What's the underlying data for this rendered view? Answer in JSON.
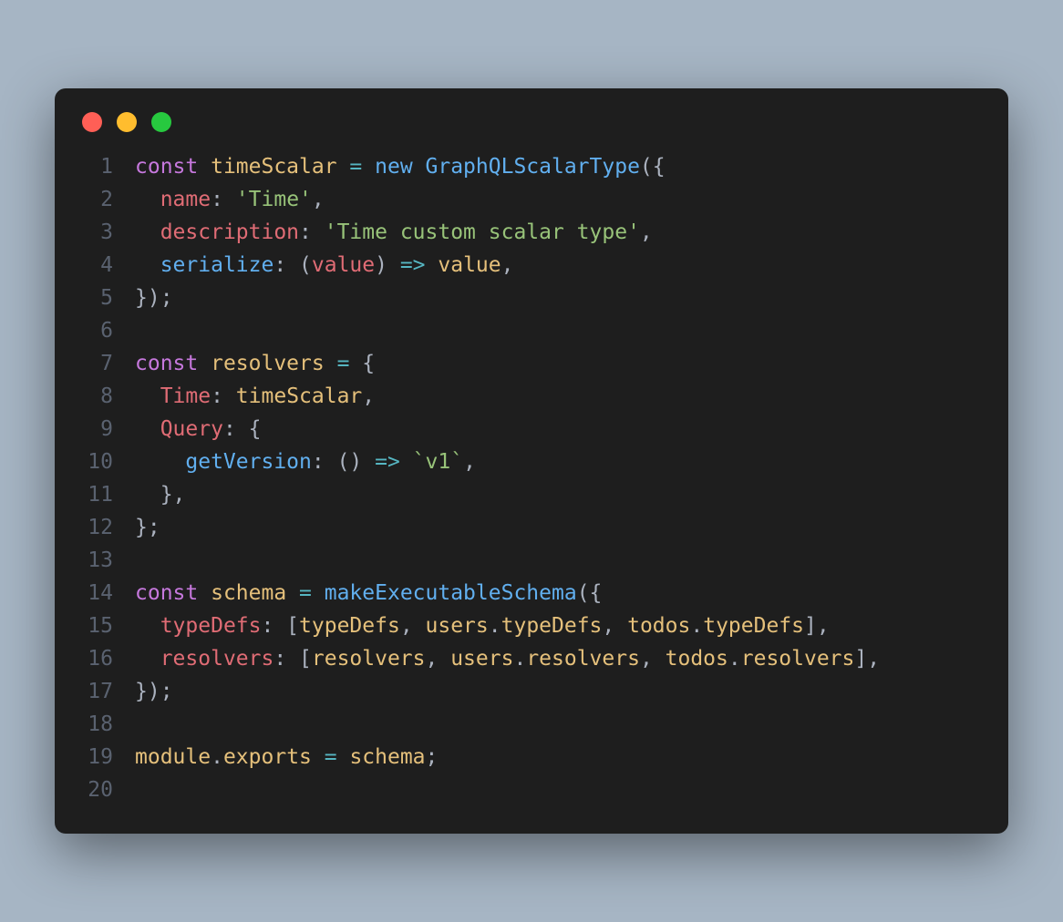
{
  "window": {
    "traffic_lights": [
      "red",
      "yellow",
      "green"
    ]
  },
  "code": {
    "lines": [
      {
        "n": "1",
        "tokens": [
          [
            "kw",
            "const"
          ],
          [
            "",
            ""
          ],
          [
            "var",
            " timeScalar"
          ],
          [
            "op",
            " ="
          ],
          [
            "new",
            " new"
          ],
          [
            "fn",
            " GraphQLScalarType"
          ],
          [
            "punc",
            "({"
          ]
        ]
      },
      {
        "n": "2",
        "tokens": [
          [
            "",
            "  "
          ],
          [
            "prop",
            "name"
          ],
          [
            "punc",
            ":"
          ],
          [
            "",
            ""
          ],
          [
            "str",
            " 'Time'"
          ],
          [
            "punc",
            ","
          ]
        ]
      },
      {
        "n": "3",
        "tokens": [
          [
            "",
            "  "
          ],
          [
            "prop",
            "description"
          ],
          [
            "punc",
            ":"
          ],
          [
            "",
            ""
          ],
          [
            "str",
            " 'Time custom scalar type'"
          ],
          [
            "punc",
            ","
          ]
        ]
      },
      {
        "n": "4",
        "tokens": [
          [
            "",
            "  "
          ],
          [
            "fn",
            "serialize"
          ],
          [
            "punc",
            ": ("
          ],
          [
            "param",
            "value"
          ],
          [
            "punc",
            ")"
          ],
          [
            "op",
            " =>"
          ],
          [
            "var",
            " value"
          ],
          [
            "punc",
            ","
          ]
        ]
      },
      {
        "n": "5",
        "tokens": [
          [
            "punc",
            "});"
          ]
        ]
      },
      {
        "n": "6",
        "tokens": [
          [
            "",
            ""
          ]
        ]
      },
      {
        "n": "7",
        "tokens": [
          [
            "kw",
            "const"
          ],
          [
            "var",
            " resolvers"
          ],
          [
            "op",
            " ="
          ],
          [
            "punc",
            " {"
          ]
        ]
      },
      {
        "n": "8",
        "tokens": [
          [
            "",
            "  "
          ],
          [
            "prop",
            "Time"
          ],
          [
            "punc",
            ":"
          ],
          [
            "var",
            " timeScalar"
          ],
          [
            "punc",
            ","
          ]
        ]
      },
      {
        "n": "9",
        "tokens": [
          [
            "",
            "  "
          ],
          [
            "prop",
            "Query"
          ],
          [
            "punc",
            ": {"
          ]
        ]
      },
      {
        "n": "10",
        "tokens": [
          [
            "",
            "    "
          ],
          [
            "fn",
            "getVersion"
          ],
          [
            "punc",
            ": ()"
          ],
          [
            "op",
            " =>"
          ],
          [
            "str",
            " `v1`"
          ],
          [
            "punc",
            ","
          ]
        ]
      },
      {
        "n": "11",
        "tokens": [
          [
            "",
            "  "
          ],
          [
            "punc",
            "},"
          ]
        ]
      },
      {
        "n": "12",
        "tokens": [
          [
            "punc",
            "};"
          ]
        ]
      },
      {
        "n": "13",
        "tokens": [
          [
            "",
            ""
          ]
        ]
      },
      {
        "n": "14",
        "tokens": [
          [
            "kw",
            "const"
          ],
          [
            "var",
            " schema"
          ],
          [
            "op",
            " ="
          ],
          [
            "fn",
            " makeExecutableSchema"
          ],
          [
            "punc",
            "({"
          ]
        ]
      },
      {
        "n": "15",
        "tokens": [
          [
            "",
            "  "
          ],
          [
            "prop",
            "typeDefs"
          ],
          [
            "punc",
            ": ["
          ],
          [
            "var",
            "typeDefs"
          ],
          [
            "punc",
            ", "
          ],
          [
            "var",
            "users"
          ],
          [
            "punc",
            "."
          ],
          [
            "var",
            "typeDefs"
          ],
          [
            "punc",
            ", "
          ],
          [
            "var",
            "todos"
          ],
          [
            "punc",
            "."
          ],
          [
            "var",
            "typeDefs"
          ],
          [
            "punc",
            "],"
          ]
        ]
      },
      {
        "n": "16",
        "tokens": [
          [
            "",
            "  "
          ],
          [
            "prop",
            "resolvers"
          ],
          [
            "punc",
            ": ["
          ],
          [
            "var",
            "resolvers"
          ],
          [
            "punc",
            ", "
          ],
          [
            "var",
            "users"
          ],
          [
            "punc",
            "."
          ],
          [
            "var",
            "resolvers"
          ],
          [
            "punc",
            ", "
          ],
          [
            "var",
            "todos"
          ],
          [
            "punc",
            "."
          ],
          [
            "var",
            "resolvers"
          ],
          [
            "punc",
            "],"
          ]
        ]
      },
      {
        "n": "17",
        "tokens": [
          [
            "punc",
            "});"
          ]
        ]
      },
      {
        "n": "18",
        "tokens": [
          [
            "",
            ""
          ]
        ]
      },
      {
        "n": "19",
        "tokens": [
          [
            "var",
            "module"
          ],
          [
            "punc",
            "."
          ],
          [
            "var",
            "exports"
          ],
          [
            "op",
            " ="
          ],
          [
            "var",
            " schema"
          ],
          [
            "punc",
            ";"
          ]
        ]
      },
      {
        "n": "20",
        "tokens": [
          [
            "",
            ""
          ]
        ]
      }
    ]
  }
}
